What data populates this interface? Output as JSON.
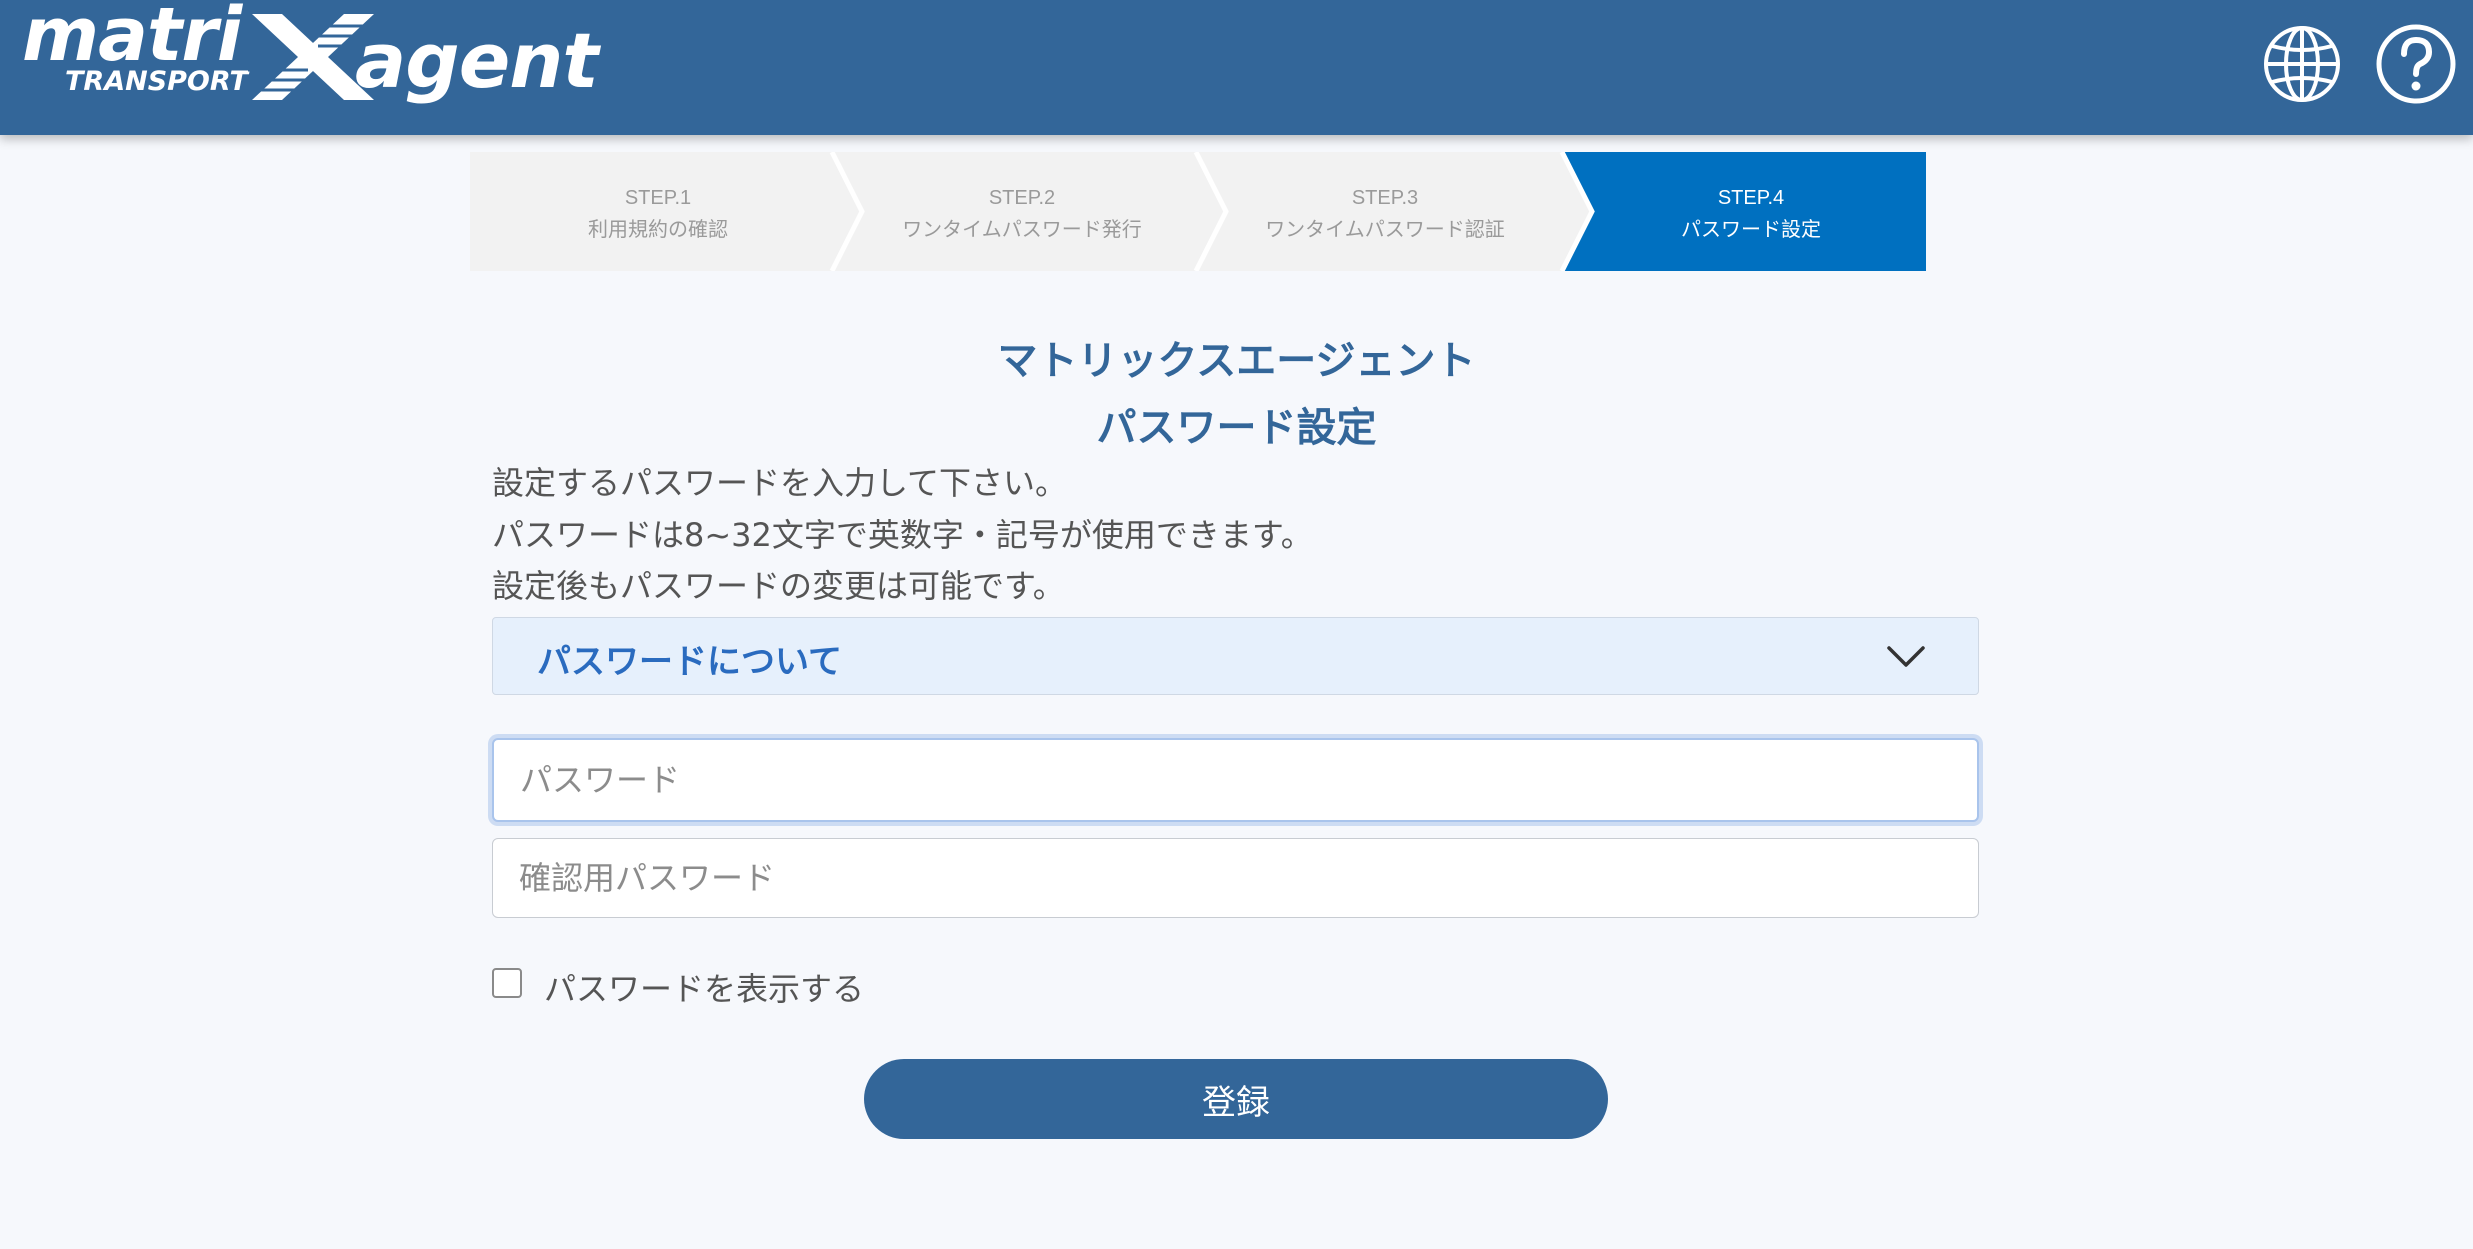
{
  "header": {
    "logo": {
      "word1": "matri",
      "word2": "agent",
      "sub": "TRANSPORT",
      "x_mark": "X"
    },
    "icons": {
      "language": "globe-icon",
      "help": "help-icon"
    },
    "color": "#336699"
  },
  "steps": [
    {
      "step": "STEP.1",
      "label": "利用規約の確認",
      "active": false
    },
    {
      "step": "STEP.2",
      "label": "ワンタイムパスワード発行",
      "active": false
    },
    {
      "step": "STEP.3",
      "label": "ワンタイムパスワード認証",
      "active": false
    },
    {
      "step": "STEP.4",
      "label": "パスワード設定",
      "active": true
    }
  ],
  "main": {
    "title_line1": "マトリックスエージェント",
    "title_line2": "パスワード設定",
    "description": [
      "設定するパスワードを入力して下さい。",
      "パスワードは8~32文字で英数字・記号が使用できます。",
      "設定後もパスワードの変更は可能です。"
    ],
    "accordion_label": "パスワードについて",
    "accordion_icon": "chevron-down-icon",
    "password": {
      "placeholder": "パスワード",
      "value": ""
    },
    "confirm_password": {
      "placeholder": "確認用パスワード",
      "value": ""
    },
    "show_password_label": "パスワードを表示する",
    "show_password_checked": false,
    "submit_label": "登録"
  },
  "colors": {
    "accent": "#336699",
    "active_step": "#0070c0",
    "inactive_step": "#f2f2f2",
    "accordion_bg": "#e6f0fc",
    "accordion_text": "#2a6bbf"
  }
}
